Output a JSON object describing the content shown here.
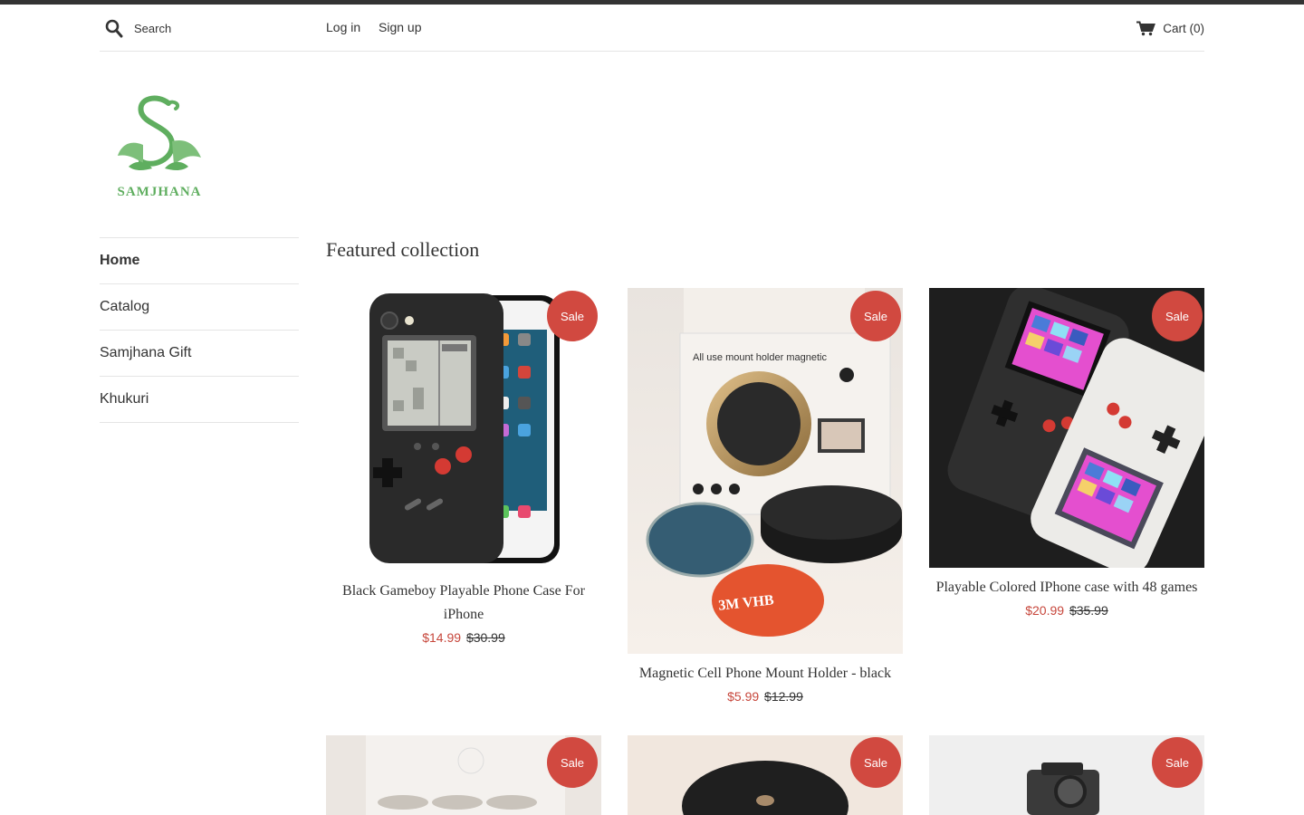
{
  "header": {
    "search_placeholder": "Search",
    "login_label": "Log in",
    "signup_label": "Sign up",
    "cart_label": "Cart (0)"
  },
  "logo": {
    "text": "SAMJHANA"
  },
  "nav": {
    "items": [
      {
        "label": "Home",
        "active": true
      },
      {
        "label": "Catalog",
        "active": false
      },
      {
        "label": "Samjhana Gift",
        "active": false
      },
      {
        "label": "Khukuri",
        "active": false
      }
    ]
  },
  "main": {
    "title": "Featured collection",
    "sale_badge": "Sale",
    "products": [
      {
        "title_line1": "Black Gameboy Playable Phone Case For",
        "title_line2": "iPhone",
        "price": "$14.99",
        "compare_price": "$30.99"
      },
      {
        "title_line1": "Magnetic Cell Phone Mount Holder - black",
        "price": "$5.99",
        "compare_price": "$12.99"
      },
      {
        "title_line1": "Playable Colored IPhone case with 48 games",
        "price": "$20.99",
        "compare_price": "$35.99"
      },
      {
        "title_line1": ""
      },
      {
        "title_line1": ""
      },
      {
        "title_line1": ""
      }
    ]
  },
  "colors": {
    "sale_badge": "#d14940",
    "sale_price": "#c7473c",
    "text": "#333333",
    "logo_green": "#5fae5f"
  }
}
